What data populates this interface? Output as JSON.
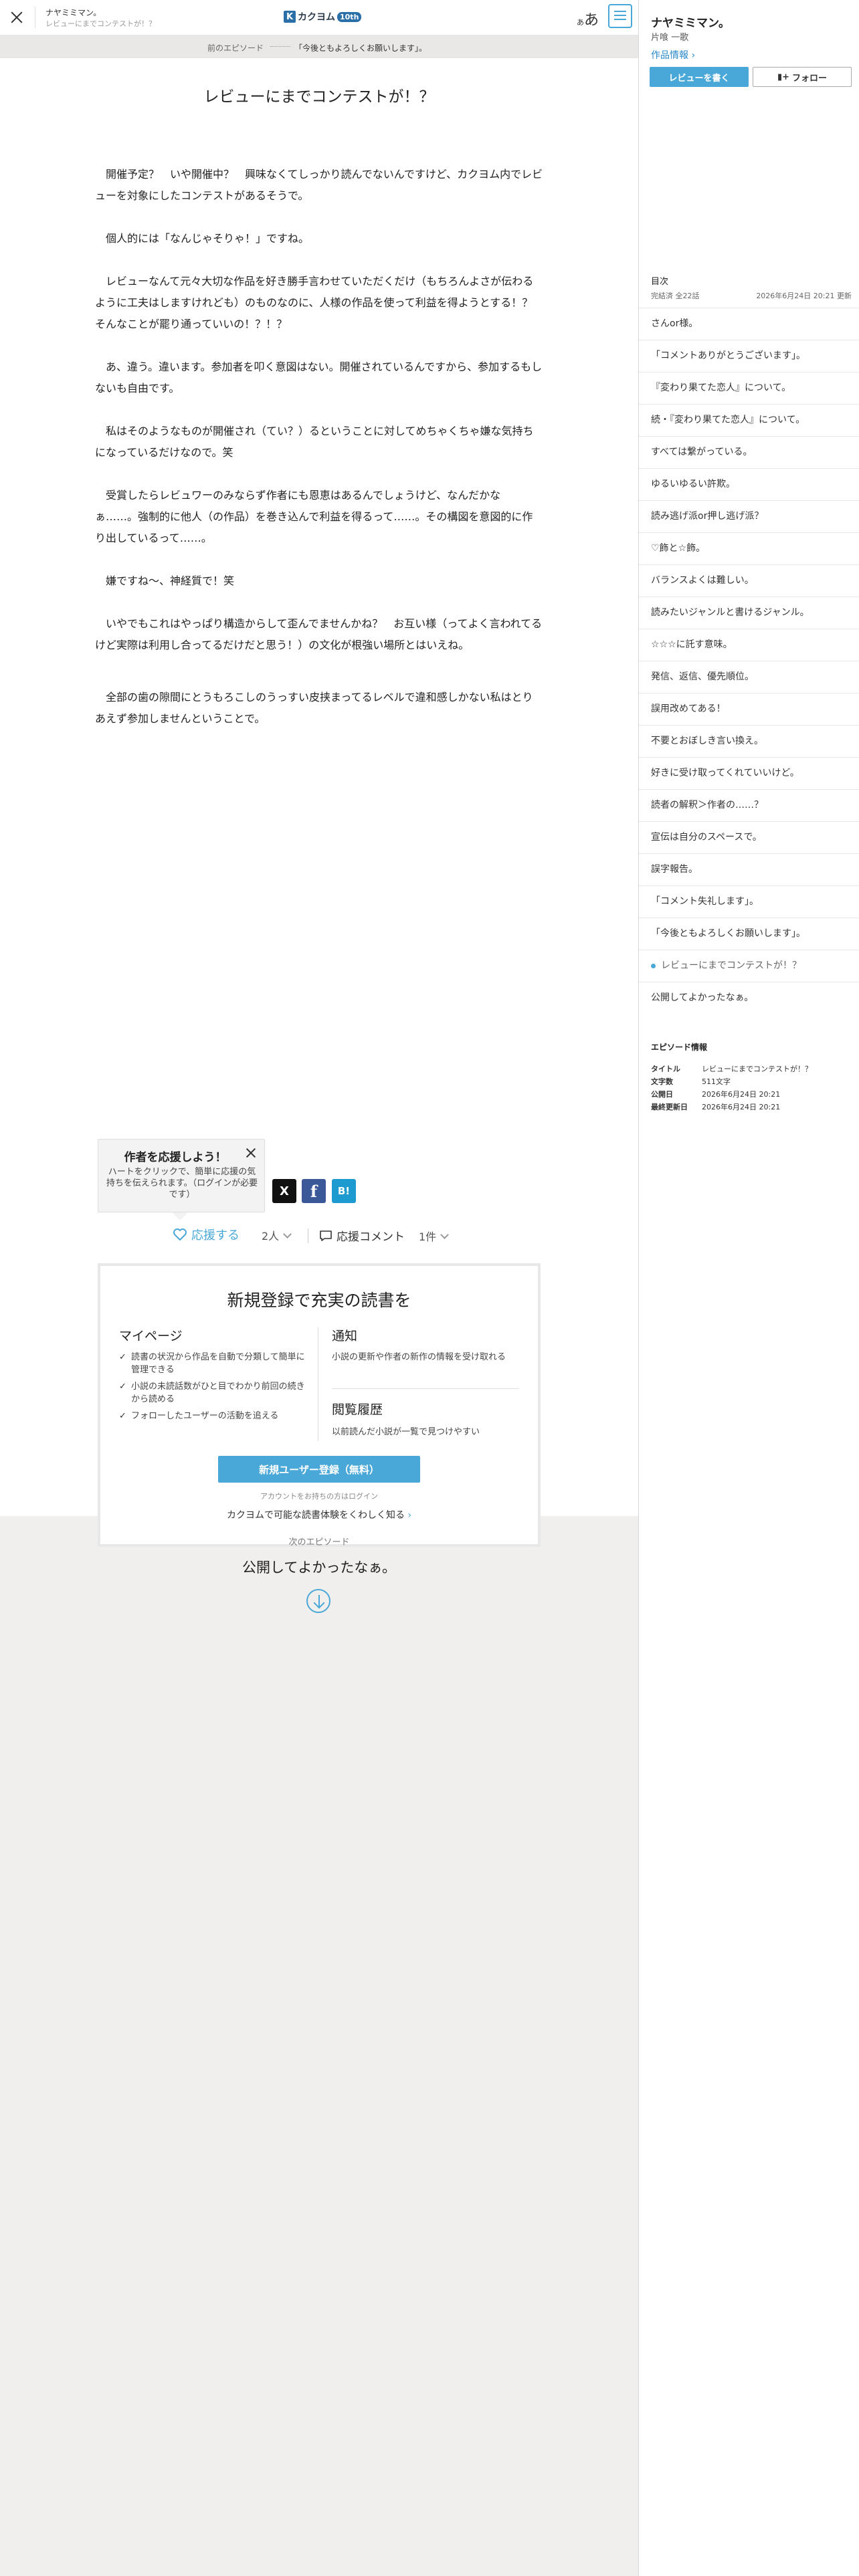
{
  "header": {
    "work_title": "ナヤミミマン。",
    "episode_title": "レビューにまでコンテストが！？",
    "logo_text": "カクヨム",
    "logo_badge": "10th",
    "font_button": "あ",
    "font_button_small": "あ"
  },
  "prev_nav": {
    "label": "前のエピソード",
    "title": "「今後ともよろしくお願いします」。"
  },
  "episode": {
    "title": "レビューにまでコンテストが！？",
    "paragraphs": [
      "開催予定？　いや開催中？　興味なくてしっかり読んでないんですけど、カクヨム内でレビューを対象にしたコンテストがあるそうで。",
      "個人的には「なんじゃそりゃ！」ですね。",
      "レビューなんて元々大切な作品を好き勝手言わせていただくだけ（もちろんよさが伝わるように工夫はしますけれども）のものなのに、人様の作品を使って利益を得ようとする！？　そんなことが罷り通っていいの！？！？",
      "あ、違う。違います。参加者を叩く意図はない。開催されているんですから、参加するもしないも自由です。",
      "私はそのようなものが開催され（てい？）るということに対してめちゃくちゃ嫌な気持ちになっているだけなので。笑",
      "受賞したらレビュワーのみならず作者にも恩恵はあるんでしょうけど、なんだかなぁ……。強制的に他人（の作品）を巻き込んで利益を得るって……。その構図を意図的に作り出しているって……。",
      "嫌ですね〜、神経質で！笑",
      "いやでもこれはやっぱり構造からして歪んでませんかね？　お互い様（ってよく言われてるけど実際は利用し合ってるだけだと思う！）の文化が根強い場所とはいえね。",
      "全部の歯の隙間にとうもろこしのうっすい皮挟まってるレベルで違和感しかない私はとりあえず参加しませんということで。"
    ]
  },
  "cheer_popup": {
    "title": "作者を応援しよう！",
    "body": "ハートをクリックで、簡単に応援の気持ちを伝えられます。（ログインが必要です）"
  },
  "share": {
    "x": "X",
    "facebook": "f",
    "hatena": "B!"
  },
  "reactions": {
    "cheer_label": "応援する",
    "cheer_count": "2人",
    "comment_label": "応援コメント",
    "comment_count": "1件"
  },
  "register": {
    "title": "新規登録で充実の読書を",
    "mypage_heading": "マイページ",
    "mypage_items": [
      "読書の状況から作品を自動で分類して簡単に管理できる",
      "小説の未読話数がひと目でわかり前回の続きから読める",
      "フォローしたユーザーの活動を追える"
    ],
    "notify_heading": "通知",
    "notify_body": "小説の更新や作者の新作の情報を受け取れる",
    "history_heading": "閲覧履歴",
    "history_body": "以前読んだ小説が一覧で見つけやすい",
    "button": "新規ユーザー登録（無料）",
    "login_link": "アカウントをお持ちの方はログイン",
    "learn_more": "カクヨムで可能な読書体験をくわしく知る"
  },
  "next_nav": {
    "label": "次のエピソード",
    "title": "公開してよかったなぁ。"
  },
  "sidebar": {
    "work_title": "ナヤミミマン。",
    "author": "片喰 一歌",
    "info_link": "作品情報",
    "review_button": "レビューを書く",
    "follow_button": "フォロー",
    "toc_heading": "目次",
    "toc_status": "完結済 全22話",
    "toc_updated": "2026年6月24日 20:21 更新",
    "toc": [
      "さんor様。",
      "「コメントありがとうございます」。",
      "『変わり果てた恋人』について。",
      "続・『変わり果てた恋人』について。",
      "すべては繋がっている。",
      "ゆるいゆるい許欺。",
      "読み逃げ派or押し逃げ派？",
      "♡飾と☆飾。",
      "バランスよくは難しい。",
      "読みたいジャンルと書けるジャンル。",
      "☆☆☆に託す意味。",
      "発信、返信、優先順位。",
      "誤用改めてある！",
      "不要とおぼしき言い換え。",
      "好きに受け取ってくれていいけど。",
      "読者の解釈＞作者の……？",
      "宣伝は自分のスペースで。",
      "誤字報告。",
      "「コメント失礼します」。",
      "「今後ともよろしくお願いします」。",
      "レビューにまでコンテストが！？",
      "公開してよかったなぁ。"
    ],
    "current_index": 20,
    "episode_info_heading": "エピソード情報",
    "episode_info": [
      {
        "label": "タイトル",
        "value": "レビューにまでコンテストが！？"
      },
      {
        "label": "文字数",
        "value": "511文字"
      },
      {
        "label": "公開日",
        "value": "2026年6月24日 20:21"
      },
      {
        "label": "最終更新日",
        "value": "2026年6月24日 20:21"
      }
    ]
  },
  "colors": {
    "accent": "#4aa8d8",
    "brand": "#2a6fa8"
  }
}
